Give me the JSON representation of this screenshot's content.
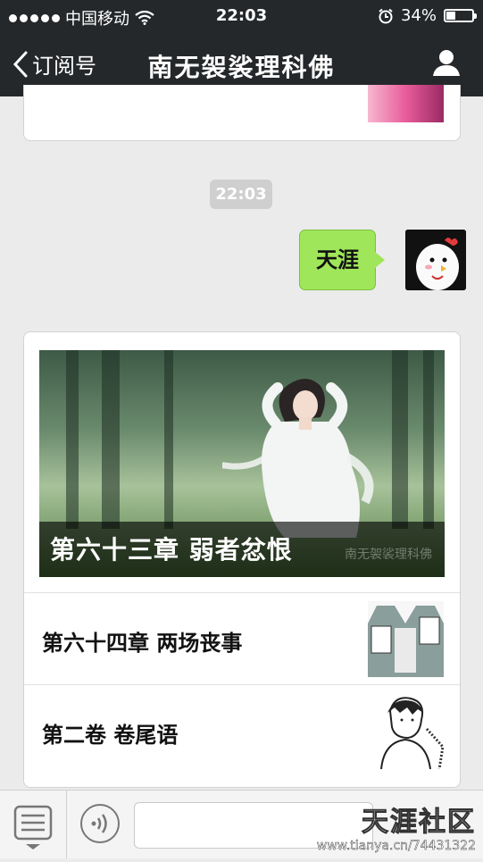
{
  "status_bar": {
    "carrier": "中国移动",
    "time": "22:03",
    "battery_percent": "34%",
    "icons": [
      "signal-dots-icon",
      "wifi-icon",
      "alarm-icon",
      "battery-icon"
    ]
  },
  "nav_bar": {
    "back_label": "订阅号",
    "title": "南无袈裟理科佛",
    "icons": [
      "chevron-left-icon",
      "profile-icon"
    ]
  },
  "chat": {
    "timestamp": "22:03",
    "sent_message": "天涯",
    "article_card": {
      "cover_caption": "第六十三章 弱者忿恨",
      "cover_watermark": "南无袈裟理科佛",
      "items": [
        {
          "title": "第六十四章 两场丧事"
        },
        {
          "title": "第二卷 卷尾语"
        }
      ]
    }
  },
  "bottom_bar": {
    "icons": [
      "menu-icon",
      "voice-icon"
    ],
    "input_value": ""
  },
  "watermark": {
    "brand": "天涯社区",
    "url": "www.tianya.cn/74431322"
  },
  "colors": {
    "nav_background": "#25282b",
    "chat_background": "#ebebeb",
    "sent_bubble": "#9fe65a"
  }
}
